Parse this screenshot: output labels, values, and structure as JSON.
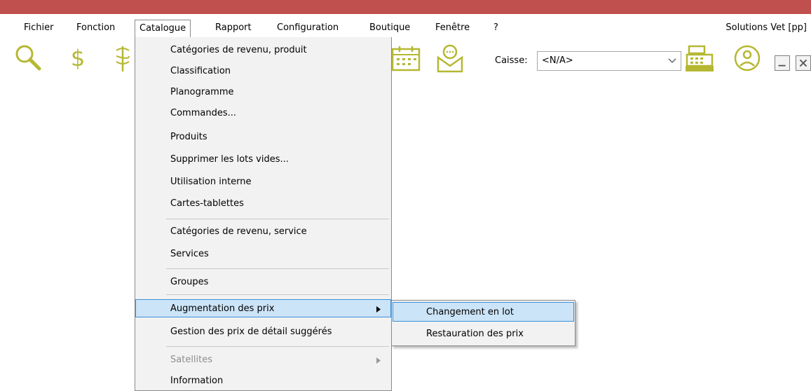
{
  "menubar": {
    "items": [
      {
        "label": "Fichier"
      },
      {
        "label": "Fonction"
      },
      {
        "label": "Catalogue"
      },
      {
        "label": "Rapport"
      },
      {
        "label": "Configuration"
      },
      {
        "label": "Boutique"
      },
      {
        "label": "Fenêtre"
      },
      {
        "label": "?"
      }
    ],
    "app_name": "Solutions Vet [pp]"
  },
  "toolbar": {
    "icons": [
      "search-icon",
      "dollar-icon",
      "caduceus-icon",
      "calendar-icon",
      "mail-icon",
      "cash-register-icon",
      "user-sync-icon"
    ],
    "caisse_label": "Caisse:",
    "caisse_value": "<N/A>",
    "accent_color": "#b5b832"
  },
  "catalogue_menu": {
    "items": [
      {
        "label": "Catégories de revenu, produit"
      },
      {
        "label": "Classification"
      },
      {
        "label": "Planogramme"
      },
      {
        "label": "Commandes..."
      },
      {
        "label": "Produits"
      },
      {
        "label": "Supprimer les lots vides..."
      },
      {
        "label": "Utilisation interne"
      },
      {
        "label": "Cartes-tablettes"
      },
      {
        "label": "Catégories de revenu, service"
      },
      {
        "label": "Services"
      },
      {
        "label": "Groupes"
      },
      {
        "label": "Augmentation des prix"
      },
      {
        "label": "Gestion des prix de détail suggérés"
      },
      {
        "label": "Satellites"
      },
      {
        "label": "Information"
      }
    ]
  },
  "submenu": {
    "items": [
      {
        "label": "Changement en lot"
      },
      {
        "label": "Restauration des prix"
      }
    ]
  },
  "colors": {
    "titlebar": "#c0504d",
    "highlight_bg": "#cce4f7",
    "highlight_border": "#3d8fd6"
  }
}
